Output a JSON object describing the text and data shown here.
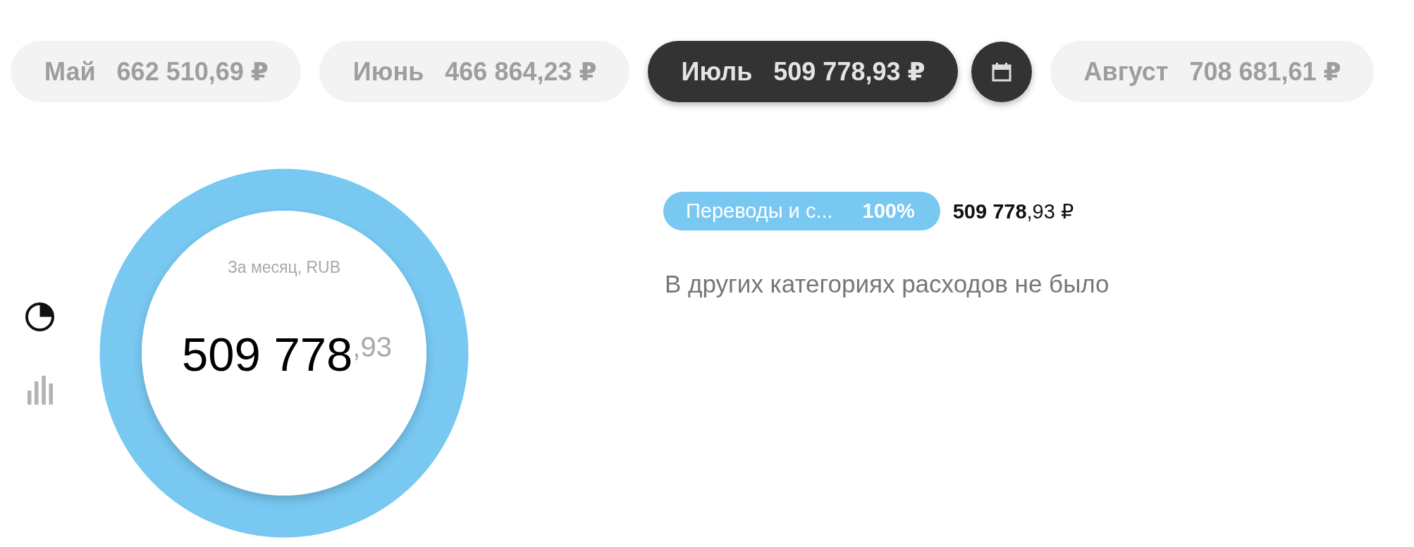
{
  "tabs": [
    {
      "label": "Май",
      "amount": "662 510,69 ₽",
      "selected": false
    },
    {
      "label": "Июнь",
      "amount": "466 864,23 ₽",
      "selected": false
    },
    {
      "label": "Июль",
      "amount": "509 778,93 ₽",
      "selected": true
    },
    {
      "label": "Август",
      "amount": "708 681,61 ₽",
      "selected": false
    }
  ],
  "view_toggles": [
    {
      "kind": "pie",
      "selected": true
    },
    {
      "kind": "bars",
      "selected": false
    }
  ],
  "donut": {
    "caption": "За месяц, RUB",
    "total": "509 778$^{,93}$"
  },
  "categories": [
    {
      "name": "Переводы и с...",
      "percent": "100%",
      "amount": "**509 778**,93 ₽",
      "color": "#78c8f2"
    }
  ],
  "note": "В других категориях расходов не было"
}
